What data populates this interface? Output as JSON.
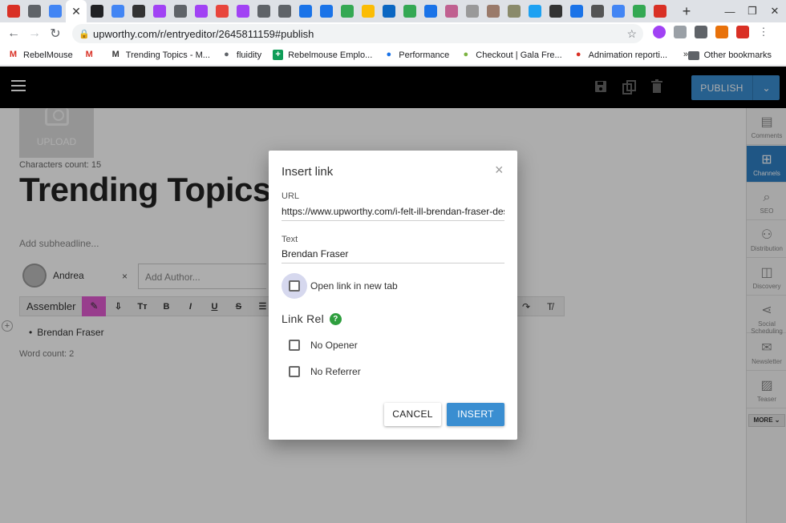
{
  "browser": {
    "url": "upworthy.com/r/entryeditor/2645811159#publish",
    "tab_favicon_colors": [
      "#d93025",
      "#5f6368",
      "#4285f4",
      "#202124",
      "#4285f4",
      "#333333",
      "#a142f4",
      "#5f6368",
      "#a142f4",
      "#e8453c",
      "#a142f4",
      "#5f6368",
      "#5f6368",
      "#1a73e8",
      "#1a73e8",
      "#34a853",
      "#fbbc04",
      "#0a66c2",
      "#34a853",
      "#1a73e8",
      "#c06090",
      "#999999",
      "#9a7a6a",
      "#8a8a6a",
      "#1da1f2",
      "#333333",
      "#1a73e8",
      "#555555",
      "#4285f4",
      "#34a853",
      "#d93025"
    ],
    "new_tab": "+",
    "window_controls": [
      "—",
      "❐",
      "✕"
    ]
  },
  "bookmarks": {
    "items": [
      {
        "label": "RebelMouse",
        "icon": "gmail-icon",
        "color": "#d93025"
      },
      {
        "label": "",
        "icon": "gmail-icon",
        "color": "#d93025"
      },
      {
        "label": "Trending Topics - M...",
        "icon": "medium-icon",
        "color": "#333333"
      },
      {
        "label": "fluidity",
        "icon": "globe-icon",
        "color": "#5f6368"
      },
      {
        "label": "Rebelmouse Emplo...",
        "icon": "plus-icon",
        "color": "#0f9d58"
      },
      {
        "label": "Performance",
        "icon": "performance-icon",
        "color": "#1a73e8"
      },
      {
        "label": "Checkout | Gala Fre...",
        "icon": "basket-icon",
        "color": "#7cb342"
      },
      {
        "label": "Adnimation reporti...",
        "icon": "ad-icon",
        "color": "#d93025"
      }
    ],
    "more": "»",
    "other": "Other bookmarks"
  },
  "app": {
    "publish_label": "PUBLISH",
    "upload_label": "UPLOAD",
    "chars_count": "Characters count: 15",
    "headline": "Trending Topics",
    "subheadline_placeholder": "Add subheadline...",
    "author_name": "Andrea",
    "author_remove": "×",
    "add_author_placeholder": "Add Author...",
    "assembler_label": "Assembler",
    "bullet_text": "Brendan Fraser",
    "word_count": "Word count: 2",
    "add_block": "+"
  },
  "sidebar": {
    "items": [
      {
        "label": "Comments",
        "icon": "comments-icon"
      },
      {
        "label": "Channels",
        "icon": "channels-icon"
      },
      {
        "label": "SEO",
        "icon": "seo-icon"
      },
      {
        "label": "Distribution",
        "icon": "distribution-icon"
      },
      {
        "label": "Discovery",
        "icon": "discovery-icon"
      },
      {
        "label": "Social Scheduling",
        "icon": "share-icon"
      },
      {
        "label": "Newsletter",
        "icon": "mail-icon"
      },
      {
        "label": "Teaser",
        "icon": "image-icon"
      }
    ],
    "active_index": 1,
    "more_label": "MORE"
  },
  "modal": {
    "title": "Insert link",
    "url_label": "URL",
    "url_value": "https://www.upworthy.com/i-felt-ill-brendan-fraser-desc",
    "text_label": "Text",
    "text_value": "Brendan Fraser",
    "new_tab_label": "Open link in new tab",
    "link_rel_title": "Link Rel",
    "help": "?",
    "no_opener": "No Opener",
    "no_referrer": "No Referrer",
    "cancel": "CANCEL",
    "insert": "INSERT",
    "close": "×"
  },
  "colors": {
    "accent": "#3a8ed1",
    "appbar": "#000000",
    "highlight": "#e05bd0",
    "help_green": "#2e9e3e"
  }
}
